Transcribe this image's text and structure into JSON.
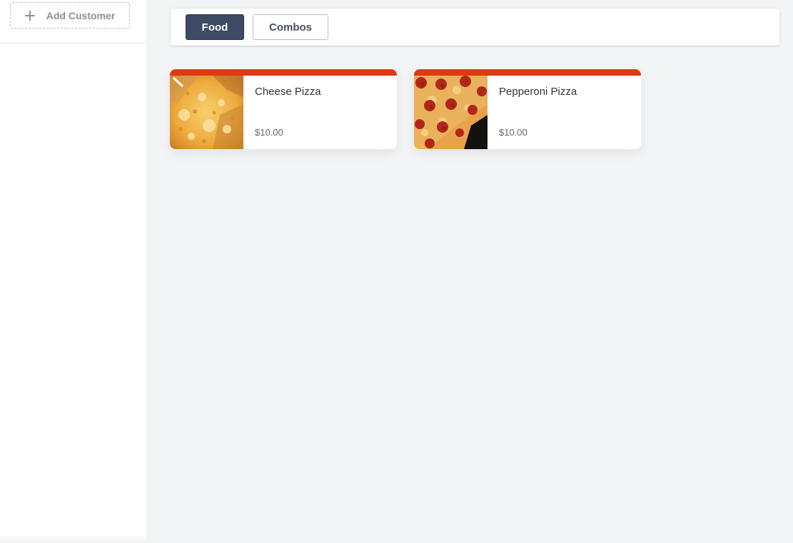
{
  "sidebar": {
    "add_customer_label": "Add Customer"
  },
  "categories": [
    {
      "label": "Food",
      "active": true
    },
    {
      "label": "Combos",
      "active": false
    }
  ],
  "products": [
    {
      "name": "Cheese Pizza",
      "price": "$10.00",
      "image": "cheese-pizza-image"
    },
    {
      "name": "Pepperoni Pizza",
      "price": "$10.00",
      "image": "pepperoni-pizza-image"
    }
  ],
  "colors": {
    "accent_bar": "#dd3a14",
    "active_category_bg": "#3d4a66",
    "page_bg": "#f3f4f6"
  }
}
